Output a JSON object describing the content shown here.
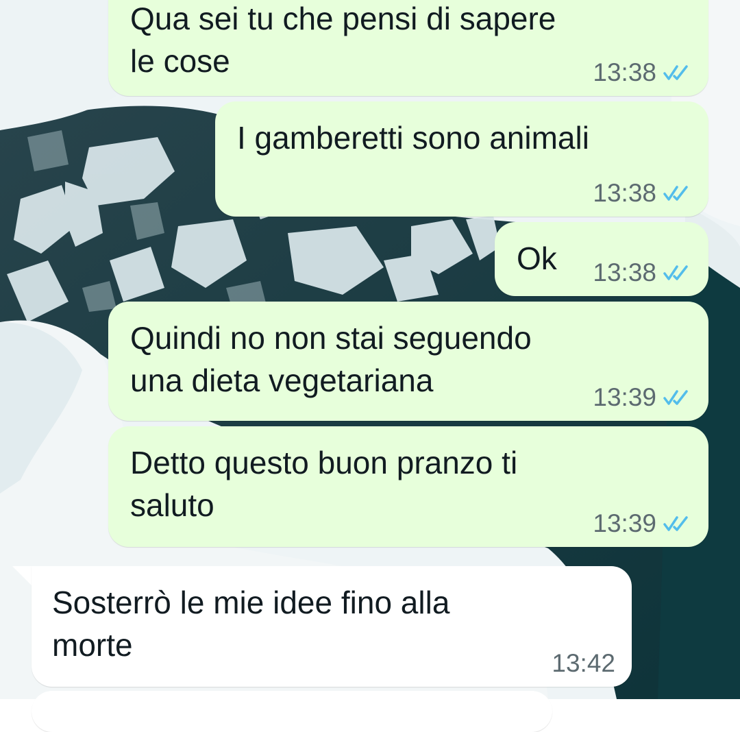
{
  "chat": {
    "messages": [
      {
        "id": "m1",
        "direction": "outgoing",
        "text": "Qua sei tu che pensi di sapere\nle cose",
        "time": "13:38",
        "status": "read"
      },
      {
        "id": "m2",
        "direction": "outgoing",
        "text": "I gamberetti sono animali",
        "time": "13:38",
        "status": "read"
      },
      {
        "id": "m3",
        "direction": "outgoing",
        "text": "Ok",
        "time": "13:38",
        "status": "read"
      },
      {
        "id": "m4",
        "direction": "outgoing",
        "text": "Quindi no non stai seguendo\nuna dieta vegetariana",
        "time": "13:39",
        "status": "read"
      },
      {
        "id": "m5",
        "direction": "outgoing",
        "text": "Detto questo buon pranzo ti\nsaluto",
        "time": "13:39",
        "status": "read"
      },
      {
        "id": "m6",
        "direction": "incoming",
        "text": "Sosterrò le mie idee fino alla\nmorte",
        "time": "13:42",
        "status": ""
      }
    ]
  },
  "colors": {
    "outgoing_bubble": "#e7ffdb",
    "incoming_bubble": "#ffffff",
    "read_ticks": "#53bdeb",
    "text": "#111b21",
    "timestamp": "#5c6a70"
  },
  "icons": {
    "read_status": "double-check-icon"
  }
}
